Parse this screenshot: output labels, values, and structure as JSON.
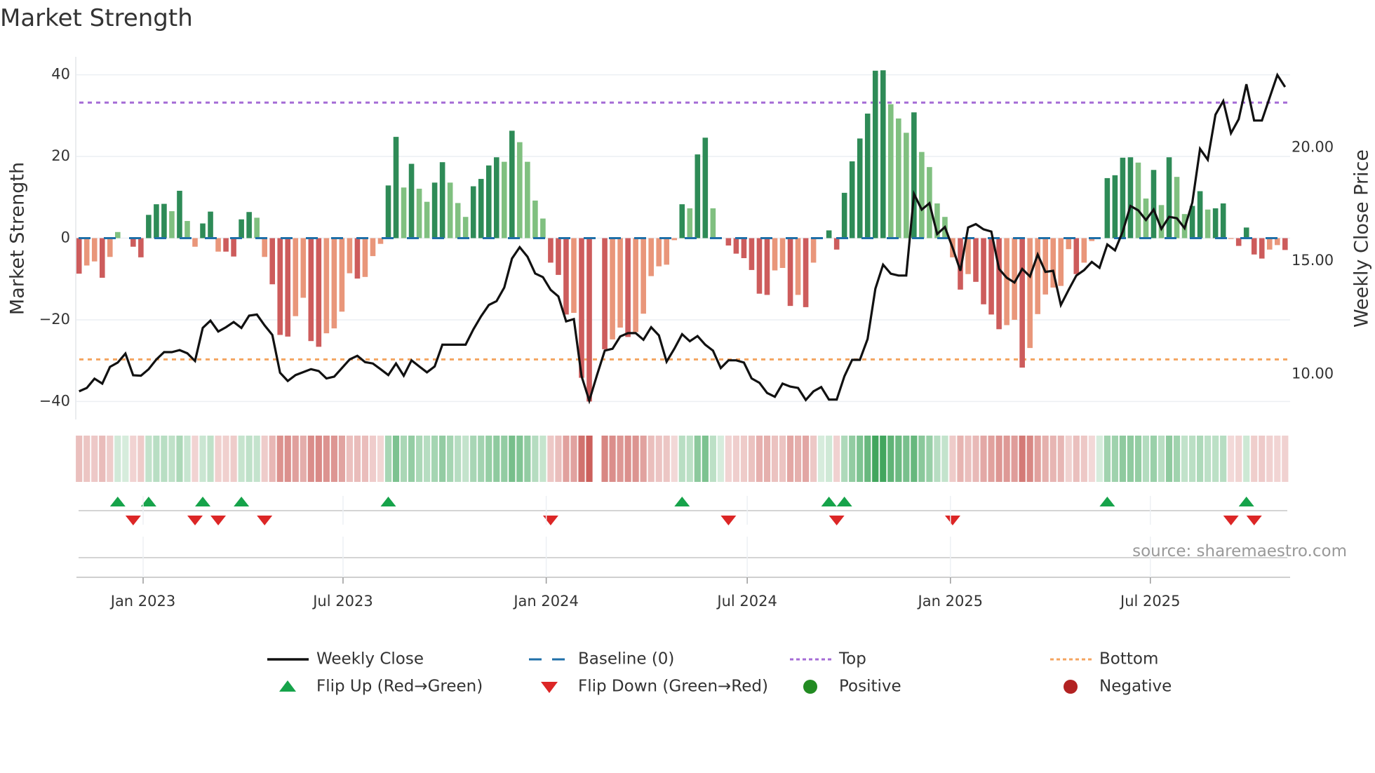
{
  "chart_data": {
    "type": "bar",
    "title": "Market Strength",
    "ylabel": "Market Strength",
    "y2label": "Weekly Close Price",
    "ylim": [
      -44.4,
      44.4
    ],
    "y2lim": [
      8.0,
      24.0
    ],
    "yticks": [
      40,
      20,
      0,
      -20,
      -40
    ],
    "yticklabels": [
      "40",
      "20",
      "0",
      "−20",
      "−40"
    ],
    "y2ticks": [
      20,
      15,
      10
    ],
    "y2ticklabels": [
      "20.00",
      "15.00",
      "10.00"
    ],
    "start_date": "2022-11-04",
    "frequency": "weekly",
    "xticks": [
      {
        "label": "Jan 2023",
        "date": "2023-01-01"
      },
      {
        "label": "Jul 2023",
        "date": "2023-07-01"
      },
      {
        "label": "Jan 2024",
        "date": "2024-01-01"
      },
      {
        "label": "Jul 2024",
        "date": "2024-07-01"
      },
      {
        "label": "Jan 2025",
        "date": "2025-01-01"
      },
      {
        "label": "Jul 2025",
        "date": "2025-07-01"
      }
    ],
    "top_level": 33.2,
    "bottom_level": -29.7,
    "baseline": 0,
    "strength": [
      -8.7,
      -6.7,
      -5.7,
      -9.7,
      -4.6,
      1.5,
      0,
      -2.1,
      -4.7,
      5.7,
      8.3,
      8.4,
      6.6,
      11.6,
      4.2,
      -2.1,
      3.6,
      6.5,
      -3.3,
      -3.3,
      -4.5,
      4.6,
      6.4,
      5.0,
      -4.6,
      -11.3,
      -23.7,
      -24.1,
      -19.1,
      -14.6,
      -25.2,
      -26.6,
      -23.3,
      -22.1,
      -18.0,
      -8.6,
      -9.9,
      -9.5,
      -4.4,
      -1.4,
      12.9,
      24.8,
      12.4,
      18.2,
      12.1,
      8.9,
      13.6,
      18.6,
      13.6,
      8.6,
      5.2,
      12.7,
      14.5,
      17.8,
      19.8,
      18.7,
      26.3,
      23.5,
      18.7,
      9.2,
      4.8,
      -6.0,
      -9.0,
      -18.7,
      -18.3,
      -34.2,
      -40.0,
      null,
      -27.2,
      -24.8,
      -21.9,
      -24.2,
      -23.0,
      -18.5,
      -9.3,
      -6.9,
      -6.5,
      -0.5,
      8.3,
      7.3,
      20.5,
      24.6,
      7.3,
      0,
      -1.8,
      -3.8,
      -4.9,
      -7.8,
      -13.6,
      -13.9,
      -7.9,
      -7.3,
      -16.6,
      -13.9,
      -16.9,
      -6.0,
      0,
      1.9,
      -2.8,
      11.1,
      18.8,
      24.4,
      30.5,
      41.0,
      41.1,
      32.8,
      29.3,
      25.8,
      30.8,
      21.1,
      17.4,
      8.5,
      5.2,
      -4.7,
      -12.6,
      -8.8,
      -10.7,
      -16.2,
      -18.7,
      -22.3,
      -21.3,
      -20.0,
      -31.7,
      -26.9,
      -18.6,
      -13.8,
      -12.1,
      -11.7,
      -2.7,
      -8.8,
      -6.0,
      -0.7,
      0,
      14.7,
      15.4,
      19.7,
      19.8,
      18.5,
      9.7,
      16.7,
      8.1,
      19.8,
      15.0,
      5.9,
      7.9,
      11.5,
      7.0,
      7.3,
      8.5,
      -0.2,
      -1.9,
      2.6,
      -4.0,
      -5.0,
      -2.8,
      -1.7,
      -2.9
    ],
    "weekly_close": [
      9.24,
      9.39,
      9.8,
      9.58,
      10.32,
      10.51,
      10.91,
      9.95,
      9.93,
      10.22,
      10.65,
      10.97,
      10.97,
      11.06,
      10.92,
      10.58,
      12.04,
      12.36,
      11.88,
      12.07,
      12.3,
      12.04,
      12.58,
      12.63,
      12.15,
      11.73,
      10.06,
      9.7,
      9.96,
      10.09,
      10.22,
      10.14,
      9.81,
      9.89,
      10.27,
      10.65,
      10.81,
      10.53,
      10.47,
      10.22,
      9.96,
      10.47,
      9.93,
      10.61,
      10.34,
      10.08,
      10.34,
      11.3,
      11.3,
      11.3,
      11.3,
      11.97,
      12.55,
      13.05,
      13.22,
      13.82,
      15.1,
      15.6,
      15.18,
      14.44,
      14.28,
      13.72,
      13.43,
      12.33,
      12.43,
      9.91,
      8.83,
      9.96,
      11.04,
      11.12,
      11.66,
      11.81,
      11.81,
      11.52,
      12.07,
      11.71,
      10.55,
      11.12,
      11.76,
      11.45,
      11.68,
      11.3,
      11.04,
      10.27,
      10.61,
      10.61,
      10.51,
      9.81,
      9.62,
      9.17,
      9.0,
      9.58,
      9.45,
      9.39,
      8.86,
      9.24,
      9.43,
      8.88,
      8.88,
      9.91,
      10.63,
      10.63,
      11.55,
      13.77,
      14.83,
      14.43,
      14.35,
      14.35,
      17.95,
      17.26,
      17.54,
      16.18,
      16.49,
      15.57,
      14.56,
      16.47,
      16.62,
      16.39,
      16.29,
      14.64,
      14.25,
      14.04,
      14.64,
      14.31,
      15.28,
      14.51,
      14.56,
      13.05,
      13.72,
      14.35,
      14.59,
      14.95,
      14.69,
      15.72,
      15.46,
      16.29,
      17.42,
      17.23,
      16.8,
      17.26,
      16.41,
      16.94,
      16.88,
      16.44,
      17.57,
      19.94,
      19.46,
      21.45,
      22.05,
      20.63,
      21.25,
      22.79,
      21.19,
      21.19,
      22.2,
      23.2,
      22.67
    ],
    "flips_up": [
      5,
      9,
      16,
      21,
      40,
      78,
      97,
      99,
      133,
      151
    ],
    "flips_down": [
      7,
      15,
      18,
      24,
      61,
      84,
      98,
      113,
      149,
      152
    ],
    "legend": [
      {
        "label": "Weekly Close",
        "kind": "line"
      },
      {
        "label": "Baseline (0)",
        "kind": "dashed"
      },
      {
        "label": "Top",
        "kind": "dotted-top"
      },
      {
        "label": "Bottom",
        "kind": "dotted-bottom"
      },
      {
        "label": "Flip Up (Red→Green)",
        "kind": "tri-up"
      },
      {
        "label": "Flip Down (Green→Red)",
        "kind": "tri-down"
      },
      {
        "label": "Positive",
        "kind": "dot-pos"
      },
      {
        "label": "Negative",
        "kind": "dot-neg"
      }
    ],
    "legend_placement": "bottom",
    "grid": true,
    "source": "source: sharemaestro.com",
    "colors": {
      "pos_strong": "#2e8b57",
      "pos_weak": "#80c080",
      "neg_strong": "#cd5c5c",
      "neg_weak": "#e9967a",
      "line": "#111111",
      "baseline": "#1f6fa8",
      "top": "#a56cd6",
      "bottom": "#f4a460",
      "flip_up": "#16a34a",
      "flip_down": "#dc2626",
      "dot_pos": "#228b22",
      "dot_neg": "#b22222"
    }
  }
}
